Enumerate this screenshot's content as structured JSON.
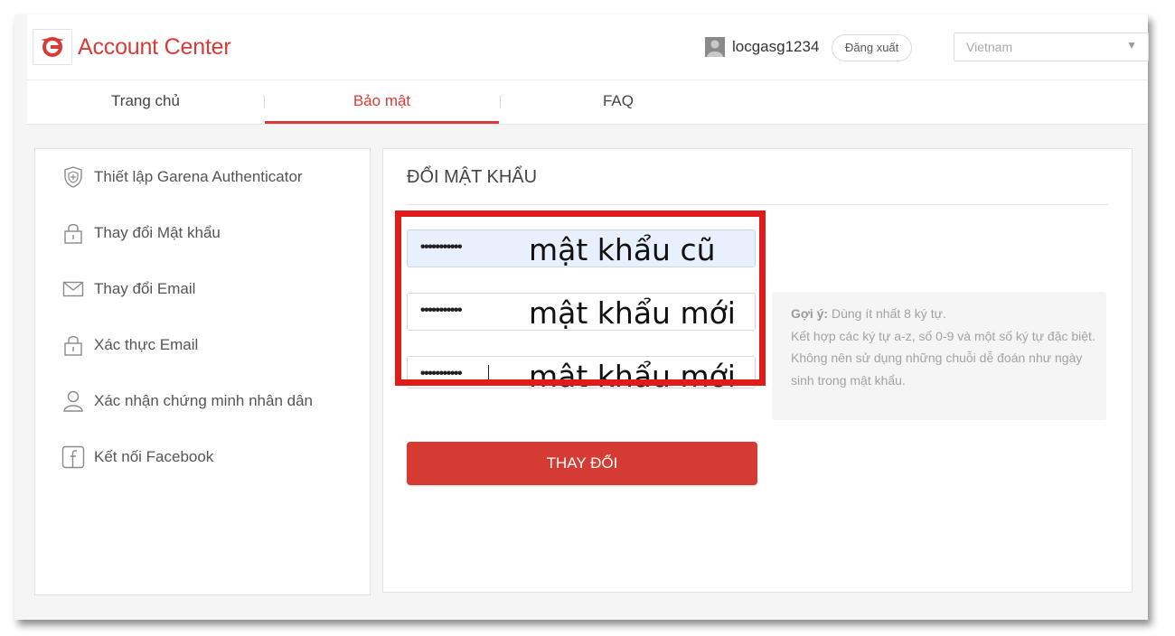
{
  "header": {
    "brand": "Account Center",
    "username": "locgasg1234",
    "logout_label": "Đăng xuất",
    "country": "Vietnam"
  },
  "tabs": [
    {
      "label": "Trang chủ"
    },
    {
      "label": "Bảo mật",
      "active": true
    },
    {
      "label": "FAQ"
    }
  ],
  "sidebar": {
    "items": [
      {
        "label": "Thiết lập Garena Authenticator",
        "icon": "shield-icon"
      },
      {
        "label": "Thay đổi Mật khẩu",
        "icon": "lock-icon"
      },
      {
        "label": "Thay đổi Email",
        "icon": "envelope-icon"
      },
      {
        "label": "Xác thực Email",
        "icon": "lock-icon"
      },
      {
        "label": "Xác nhận chứng minh nhân dân",
        "icon": "person-icon"
      },
      {
        "label": "Kết nối Facebook",
        "icon": "facebook-icon"
      }
    ]
  },
  "content": {
    "title": "ĐỔI MẬT KHẨU",
    "fields": [
      {
        "masked_value": "•••••••••••",
        "annotation": "mật khẩu cũ"
      },
      {
        "masked_value": "•••••••••••",
        "annotation": "mật khẩu mới"
      },
      {
        "masked_value": "•••••••••••",
        "annotation": "mật khẩu mới"
      }
    ],
    "hint": {
      "label": "Gợi ý:",
      "line1": "Dùng ít nhất 8 ký tự.",
      "line2": "Kết hợp các ký tự a-z, số 0-9 và một số ký tự đặc biệt.",
      "line3": "Không nên sử dụng những chuỗi dễ đoán như ngày sinh trong mật khẩu."
    },
    "submit_label": "THAY ĐỔI"
  },
  "colors": {
    "accent": "#d93a36",
    "annotation_box": "#e11a1a",
    "autofill": "#e8f0fe"
  }
}
